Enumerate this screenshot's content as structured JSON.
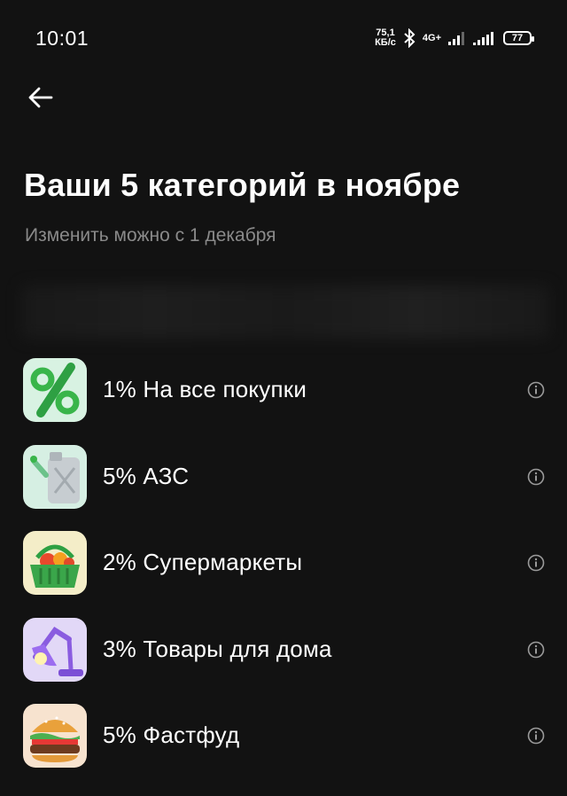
{
  "status_bar": {
    "time": "10:01",
    "speed_value": "75,1",
    "speed_unit": "КБ/с",
    "network": "4G+",
    "battery": "77"
  },
  "header": {
    "title": "Ваши 5 категорий в ноябре",
    "subtitle": "Изменить можно с 1 декабря"
  },
  "categories": [
    {
      "label": "1% На все покупки",
      "icon": "percent-icon"
    },
    {
      "label": "5% АЗС",
      "icon": "fuel-canister-icon"
    },
    {
      "label": "2% Супермаркеты",
      "icon": "grocery-basket-icon"
    },
    {
      "label": "3% Товары для дома",
      "icon": "desk-lamp-icon"
    },
    {
      "label": "5% Фастфуд",
      "icon": "burger-icon"
    }
  ],
  "colors": {
    "background": "#121212",
    "text_primary": "#ffffff",
    "text_secondary": "#8a8a8a",
    "icon_gray": "#9a9a9a"
  }
}
